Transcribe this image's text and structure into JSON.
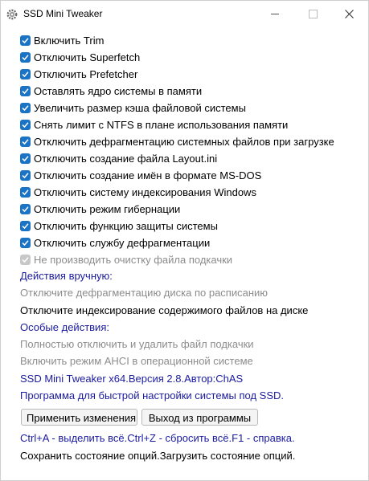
{
  "window": {
    "title": "SSD Mini Tweaker",
    "icon": "gear-icon"
  },
  "options": [
    {
      "label": "Включить Trim",
      "checked": true,
      "disabled": false
    },
    {
      "label": "Отключить Superfetch",
      "checked": true,
      "disabled": false
    },
    {
      "label": "Отключить Prefetcher",
      "checked": true,
      "disabled": false
    },
    {
      "label": "Оставлять ядро системы в памяти",
      "checked": true,
      "disabled": false
    },
    {
      "label": "Увеличить размер кэша файловой системы",
      "checked": true,
      "disabled": false
    },
    {
      "label": "Снять лимит с NTFS в плане использования памяти",
      "checked": true,
      "disabled": false
    },
    {
      "label": "Отключить дефрагментацию системных файлов при загрузке",
      "checked": true,
      "disabled": false
    },
    {
      "label": "Отключить создание файла Layout.ini",
      "checked": true,
      "disabled": false
    },
    {
      "label": "Отключить создание имён в формате MS-DOS",
      "checked": true,
      "disabled": false
    },
    {
      "label": "Отключить систему индексирования Windows",
      "checked": true,
      "disabled": false
    },
    {
      "label": "Отключить режим гибернации",
      "checked": true,
      "disabled": false
    },
    {
      "label": "Отключить функцию защиты системы",
      "checked": true,
      "disabled": false
    },
    {
      "label": "Отключить службу дефрагментации",
      "checked": true,
      "disabled": false
    },
    {
      "label": "Не производить очистку файла подкачки",
      "checked": true,
      "disabled": true
    }
  ],
  "manual": {
    "header": "Действия вручную:",
    "disable_defrag_schedule": "Отключите дефрагментацию диска по расписанию",
    "disable_content_indexing": "Отключите индексирование содержимого файлов на диске"
  },
  "special": {
    "header": "Особые действия:",
    "disable_pagefile": "Полностью отключить и удалить файл подкачки",
    "enable_ahci": "Включить режим AHCI в операционной системе"
  },
  "info": {
    "version": "SSD Mini Tweaker x64.Версия 2.8.Автор:ChAS",
    "description": "Программа для быстрой настройки системы под SSD."
  },
  "buttons": {
    "apply": "Применить изменения",
    "exit": "Выход из программы"
  },
  "footer": {
    "shortcuts": "Ctrl+A - выделить всё.Ctrl+Z - сбросить всё.F1 - справка.",
    "state": "Сохранить состояние опций.Загрузить состояние опций."
  },
  "colors": {
    "checkbox": "#1a73c4",
    "link_blue": "#1a1a9e",
    "disabled_text": "#8c8c8c"
  }
}
